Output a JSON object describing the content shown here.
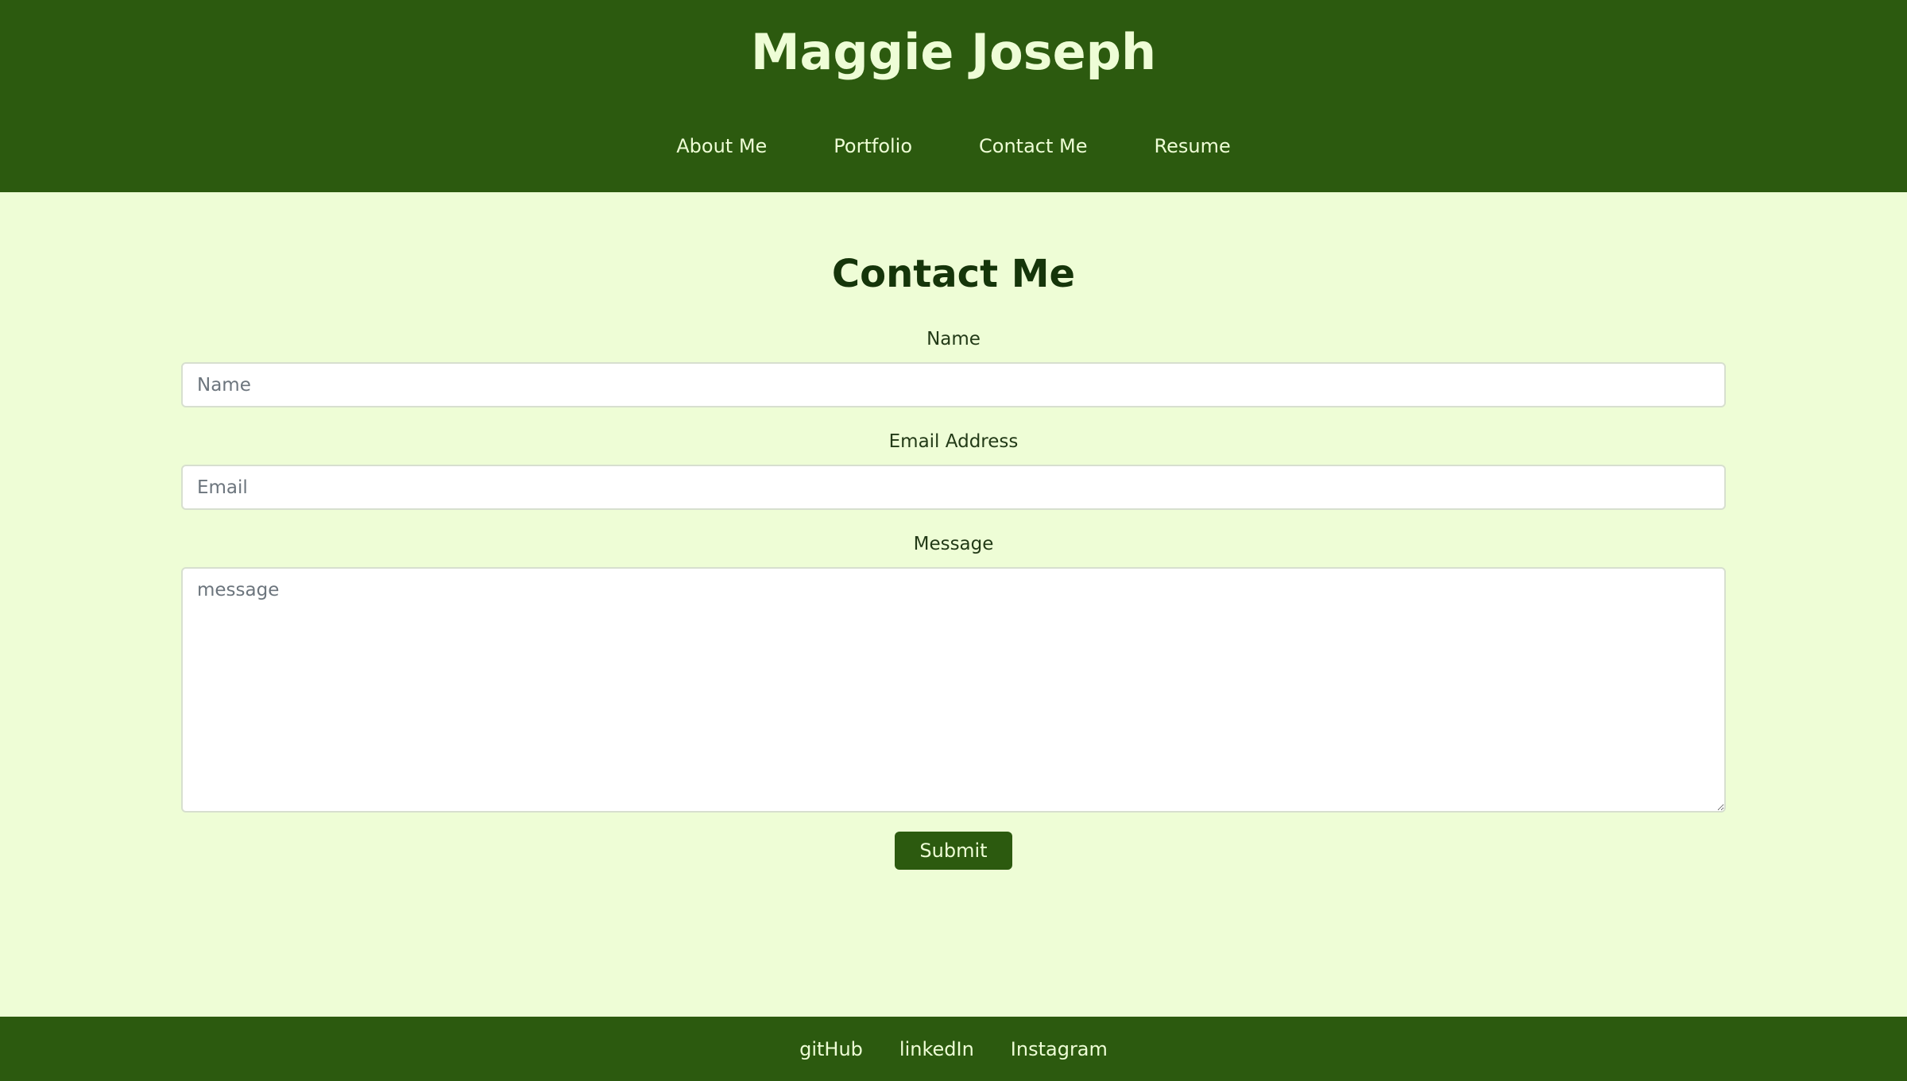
{
  "header": {
    "title": "Maggie Joseph",
    "nav": [
      {
        "label": "About Me"
      },
      {
        "label": "Portfolio"
      },
      {
        "label": "Contact Me"
      },
      {
        "label": "Resume"
      }
    ]
  },
  "contact": {
    "title": "Contact Me",
    "name_label": "Name",
    "name_placeholder": "Name",
    "name_value": "",
    "email_label": "Email Address",
    "email_placeholder": "Email",
    "email_value": "",
    "message_label": "Message",
    "message_placeholder": "message",
    "message_value": "",
    "submit_label": "Submit"
  },
  "footer": {
    "links": [
      {
        "label": "gitHub"
      },
      {
        "label": "linkedIn"
      },
      {
        "label": "Instagram"
      }
    ]
  },
  "colors": {
    "primary_green": "#2c5a0f",
    "background": "#eefdd6",
    "header_text": "#eefdd6"
  }
}
